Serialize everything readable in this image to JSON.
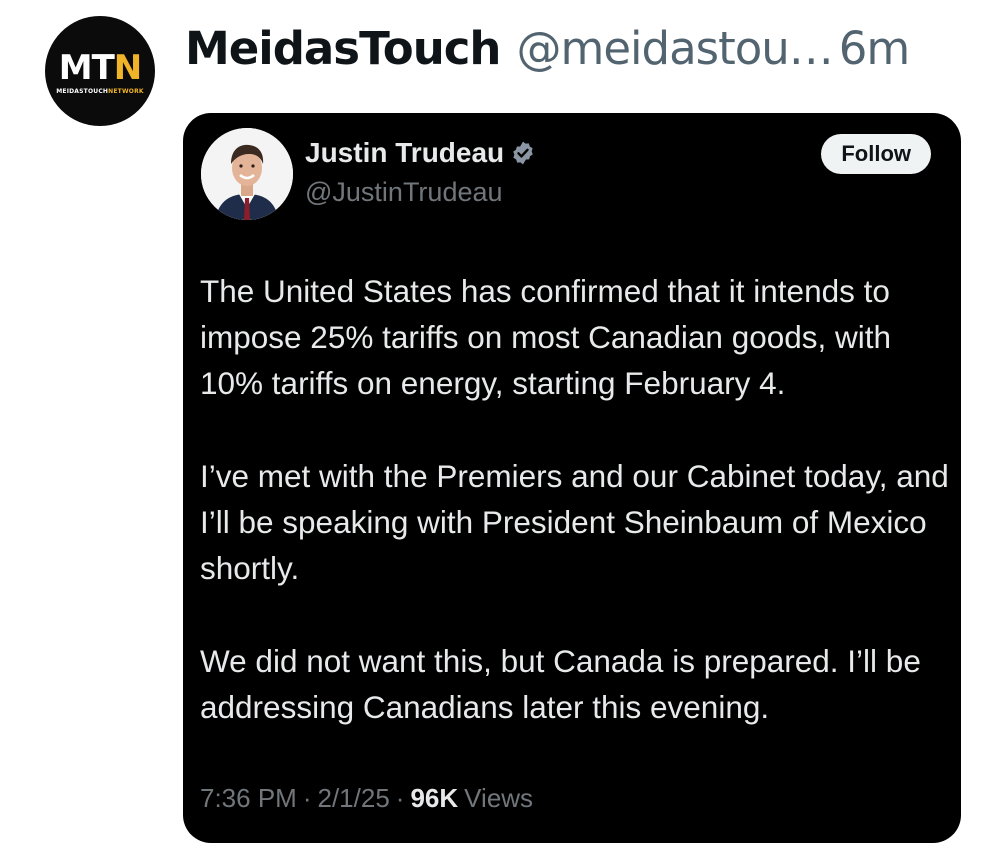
{
  "post": {
    "account_name": "MeidasTouch",
    "handle": "@meidastou…",
    "separator": "",
    "time": "6m",
    "avatar": {
      "logo_part1": "MT",
      "logo_part2": "N",
      "subtitle_part1": "MEIDASTOUCH",
      "subtitle_part2": "NETWORK"
    }
  },
  "quoted_tweet": {
    "author_name": "Justin Trudeau",
    "author_handle": "@JustinTrudeau",
    "verified_icon": "verified-badge-icon",
    "follow_label": "Follow",
    "paragraphs": [
      "The United States has confirmed that it intends to impose 25% tariffs on most Canadian goods, with 10% tariffs on energy, starting February 4.",
      "I’ve met with the Premiers and our Cabinet today, and I’ll be speaking with President Sheinbaum of Mexico shortly.",
      "We did not want this, but Canada is prepared. I’ll be addressing Canadians later this evening."
    ],
    "time": "7:36 PM",
    "date": "2/1/25",
    "views_count": "96K",
    "views_label": "Views",
    "meta_separator": "·"
  },
  "colors": {
    "card_background": "#000000",
    "verified_blue": "#8a96a3",
    "brand_gold": "#f0b429"
  }
}
